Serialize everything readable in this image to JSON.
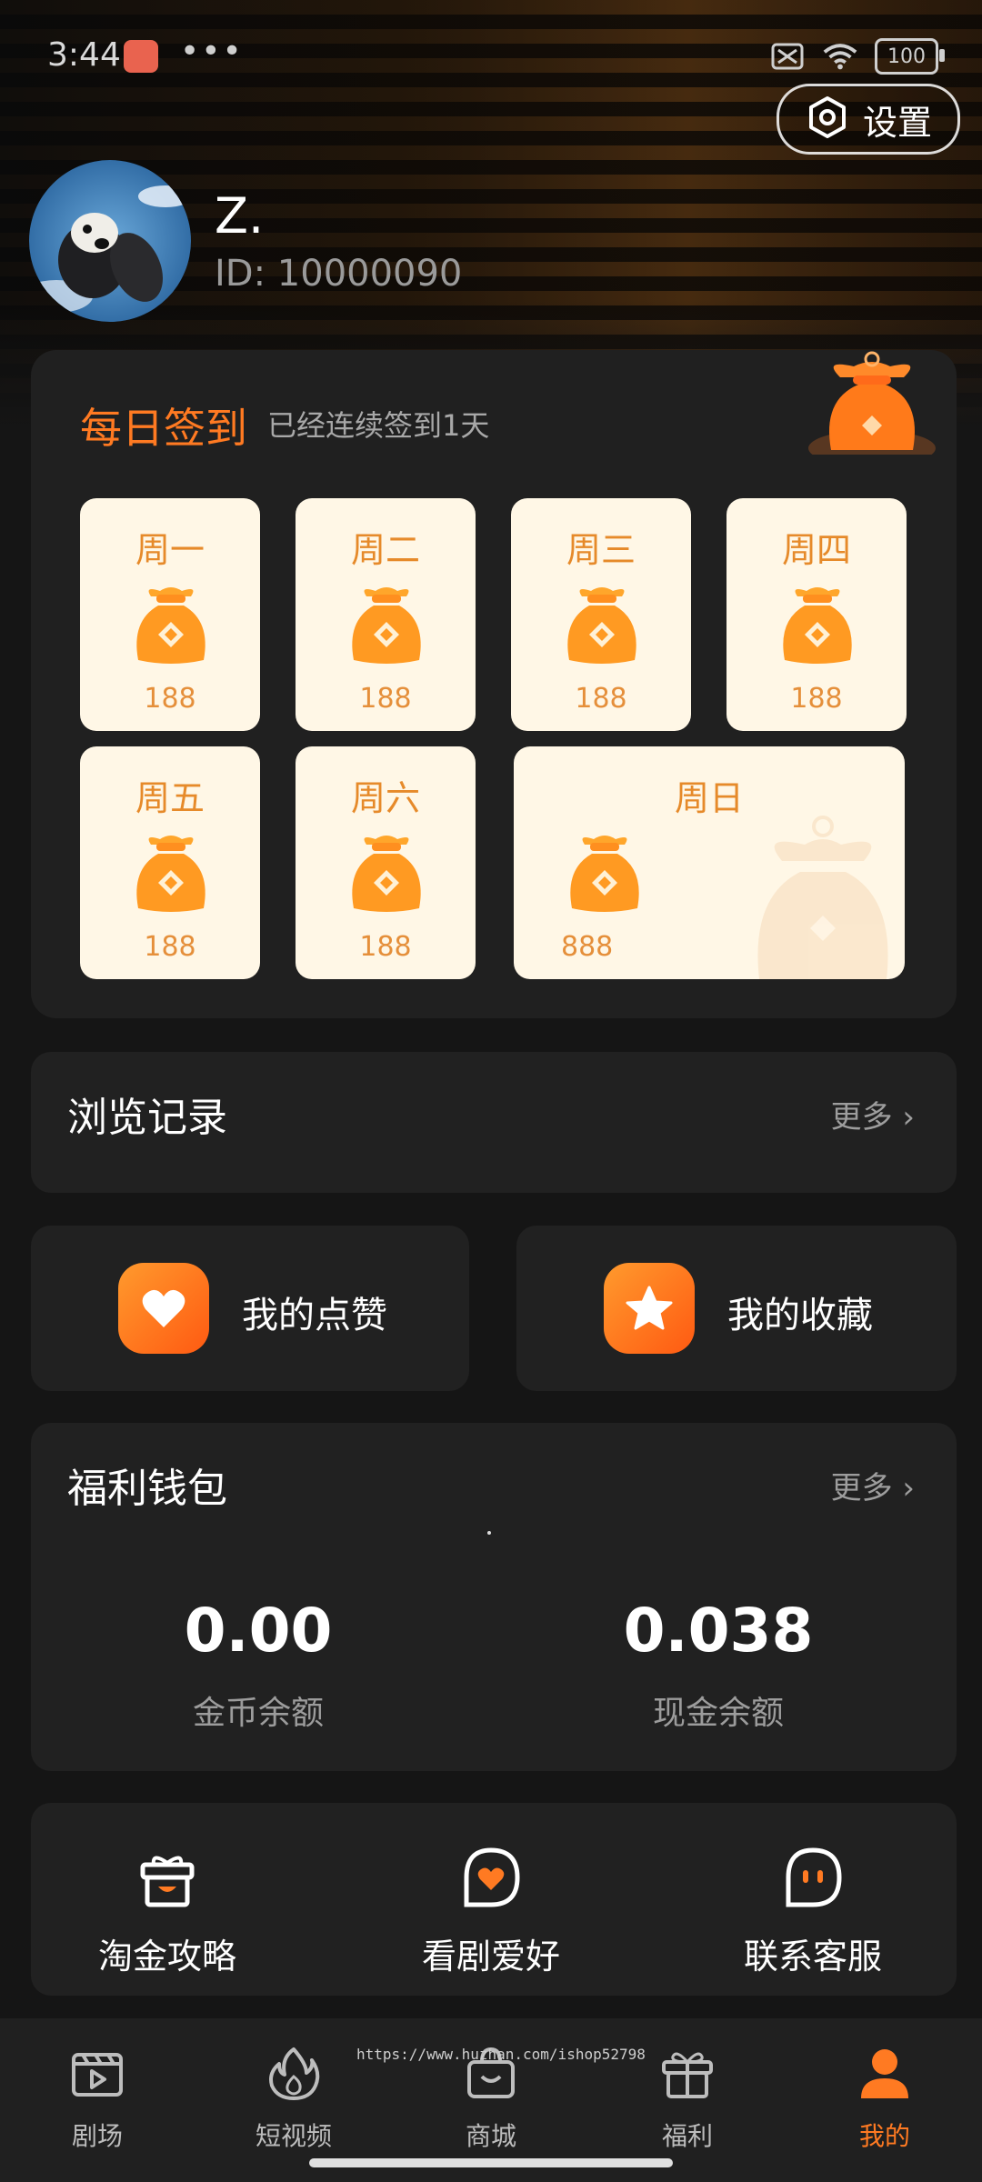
{
  "status_bar": {
    "time": "3:44",
    "dots": "•••",
    "battery": "100"
  },
  "settings": {
    "label": "设置"
  },
  "profile": {
    "name": "Z.",
    "id_text": "ID: 10000090"
  },
  "checkin": {
    "title": "每日签到",
    "subtitle": "已经连续签到1天",
    "days": [
      {
        "name": "周一",
        "value": "188"
      },
      {
        "name": "周二",
        "value": "188"
      },
      {
        "name": "周三",
        "value": "188"
      },
      {
        "name": "周四",
        "value": "188"
      },
      {
        "name": "周五",
        "value": "188"
      },
      {
        "name": "周六",
        "value": "188"
      },
      {
        "name": "周日",
        "value": "888"
      }
    ]
  },
  "history": {
    "title": "浏览记录",
    "more": "更多 ›"
  },
  "actions": {
    "likes": "我的点赞",
    "favorites": "我的收藏"
  },
  "wallet": {
    "title": "福利钱包",
    "more": "更多 ›",
    "coins_value": "0.00",
    "coins_label": "金币余额",
    "cash_value": "0.038",
    "cash_label": "现金余额"
  },
  "services": [
    {
      "label": "淘金攻略"
    },
    {
      "label": "看剧爱好"
    },
    {
      "label": "联系客服"
    }
  ],
  "nav": {
    "items": [
      {
        "label": "剧场"
      },
      {
        "label": "短视频"
      },
      {
        "label": "商城"
      },
      {
        "label": "福利"
      },
      {
        "label": "我的"
      }
    ],
    "watermark": "https://www.huzhan.com/ishop52798"
  },
  "colors": {
    "accent": "#ff7a22",
    "card": "#212121",
    "background": "#151515",
    "day_bg": "#fff7e6"
  }
}
